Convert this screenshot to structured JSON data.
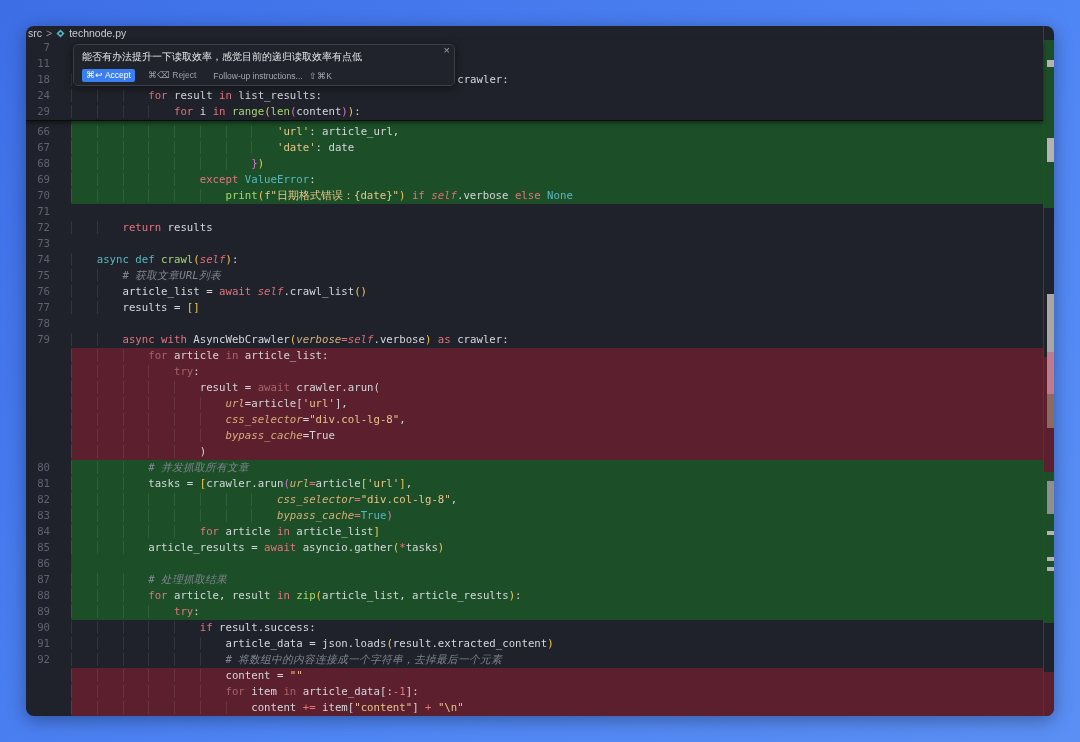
{
  "breadcrumb": {
    "folder": "src",
    "separator": ">",
    "file": "technode.py"
  },
  "prompt_popup": {
    "prompt": "能否有办法提升一下读取效率，感觉目前的递归读取效率有点低",
    "accept": "⌘↩ Accept",
    "reject": "⌘⌫ Reject",
    "followup_placeholder": "Follow-up instructions...",
    "followup_shortcut": "⇧⌘K",
    "close": "×"
  },
  "sticky_lines": [
    {
      "num": "7"
    },
    {
      "num": "11"
    },
    {
      "num": "18",
      "code": [
        {
          "text": "                                                            crawler:",
          "kind": "plain"
        }
      ]
    },
    {
      "num": "24",
      "code": [
        {
          "text": "            for ",
          "kind": "keyword"
        },
        {
          "text": "result ",
          "kind": "plain"
        },
        {
          "text": "in ",
          "kind": "keyword"
        },
        {
          "text": "list_results:",
          "kind": "plain"
        }
      ]
    },
    {
      "num": "29",
      "code": [
        {
          "text": "                for ",
          "kind": "keyword"
        },
        {
          "text": "i ",
          "kind": "plain"
        },
        {
          "text": "in ",
          "kind": "keyword"
        },
        {
          "text": "range",
          "kind": "function"
        },
        {
          "text": "(",
          "kind": "bracket"
        },
        {
          "text": "len",
          "kind": "function"
        },
        {
          "text": "(",
          "kind": "bracket2"
        },
        {
          "text": "content",
          "kind": "plain"
        },
        {
          "text": ")",
          "kind": "bracket2"
        },
        {
          "text": ")",
          "kind": "bracket"
        },
        {
          "text": ":",
          "kind": "plain"
        }
      ]
    }
  ],
  "lines": [
    {
      "num": "66",
      "kind": "added",
      "code": [
        {
          "text": "                                'url'",
          "kind": "string"
        },
        {
          "text": ": article_url,",
          "kind": "plain"
        }
      ]
    },
    {
      "num": "67",
      "kind": "added",
      "code": [
        {
          "text": "                                'date'",
          "kind": "string"
        },
        {
          "text": ": date",
          "kind": "plain"
        }
      ]
    },
    {
      "num": "68",
      "kind": "added",
      "code": [
        {
          "text": "                            }",
          "kind": "bracket2"
        },
        {
          "text": ")",
          "kind": "bracket"
        }
      ]
    },
    {
      "num": "69",
      "kind": "added",
      "code": [
        {
          "text": "                    except ",
          "kind": "keyword"
        },
        {
          "text": "ValueError",
          "kind": "constant"
        },
        {
          "text": ":",
          "kind": "plain"
        }
      ]
    },
    {
      "num": "70",
      "kind": "added",
      "code": [
        {
          "text": "                        print",
          "kind": "function"
        },
        {
          "text": "(",
          "kind": "bracket"
        },
        {
          "text": "f\"日期格式错误：{date}\"",
          "kind": "string"
        },
        {
          "text": ") ",
          "kind": "bracket"
        },
        {
          "text": "if ",
          "kind": "keyword"
        },
        {
          "text": "self",
          "kind": "self"
        },
        {
          "text": ".verbose ",
          "kind": "plain"
        },
        {
          "text": "else ",
          "kind": "keyword"
        },
        {
          "text": "None",
          "kind": "constant"
        }
      ]
    },
    {
      "num": "71",
      "kind": "plain"
    },
    {
      "num": "72",
      "kind": "plain",
      "code": [
        {
          "text": "        return ",
          "kind": "keyword"
        },
        {
          "text": "results",
          "kind": "plain"
        }
      ]
    },
    {
      "num": "73",
      "kind": "plain"
    },
    {
      "num": "74",
      "kind": "plain",
      "code": [
        {
          "text": "    async def ",
          "kind": "declaration"
        },
        {
          "text": "crawl",
          "kind": "function"
        },
        {
          "text": "(",
          "kind": "bracket"
        },
        {
          "text": "self",
          "kind": "self"
        },
        {
          "text": ")",
          "kind": "bracket"
        },
        {
          "text": ":",
          "kind": "plain"
        }
      ]
    },
    {
      "num": "75",
      "kind": "plain",
      "code": [
        {
          "text": "        # 获取文章URL列表",
          "kind": "comment"
        }
      ]
    },
    {
      "num": "76",
      "kind": "plain",
      "code": [
        {
          "text": "        article_list = ",
          "kind": "plain"
        },
        {
          "text": "await ",
          "kind": "keyword"
        },
        {
          "text": "self",
          "kind": "self"
        },
        {
          "text": ".crawl_list",
          "kind": "plain"
        },
        {
          "text": "()",
          "kind": "bracket"
        }
      ]
    },
    {
      "num": "77",
      "kind": "plain",
      "code": [
        {
          "text": "        results = ",
          "kind": "plain"
        },
        {
          "text": "[]",
          "kind": "bracket"
        }
      ]
    },
    {
      "num": "78",
      "kind": "plain"
    },
    {
      "num": "79",
      "kind": "plain",
      "code": [
        {
          "text": "        async with ",
          "kind": "keyword"
        },
        {
          "text": "AsyncWebCrawler",
          "kind": "plain"
        },
        {
          "text": "(",
          "kind": "bracket"
        },
        {
          "text": "verbose",
          "kind": "param"
        },
        {
          "text": "=",
          "kind": "operator"
        },
        {
          "text": "self",
          "kind": "self"
        },
        {
          "text": ".verbose",
          "kind": "plain"
        },
        {
          "text": ") ",
          "kind": "bracket"
        },
        {
          "text": "as ",
          "kind": "keyword"
        },
        {
          "text": "crawler:",
          "kind": "plain"
        }
      ]
    },
    {
      "kind": "deleted",
      "code": [
        {
          "text": "            for ",
          "kind": "keyword"
        },
        {
          "text": "article ",
          "kind": "plain"
        },
        {
          "text": "in ",
          "kind": "keyword"
        },
        {
          "text": "article_list:",
          "kind": "plain"
        }
      ]
    },
    {
      "kind": "deleted",
      "code": [
        {
          "text": "                try",
          "kind": "keyword"
        },
        {
          "text": ":",
          "kind": "plain"
        }
      ]
    },
    {
      "kind": "deleted",
      "code": [
        {
          "text": "                    result = ",
          "kind": "plain"
        },
        {
          "text": "await ",
          "kind": "keyword"
        },
        {
          "text": "crawler.arun(",
          "kind": "plain"
        }
      ]
    },
    {
      "kind": "deleted",
      "code": [
        {
          "text": "                        url",
          "kind": "param"
        },
        {
          "text": "=article[",
          "kind": "plain"
        },
        {
          "text": "'url'",
          "kind": "string"
        },
        {
          "text": "],",
          "kind": "plain"
        }
      ]
    },
    {
      "kind": "deleted",
      "code": [
        {
          "text": "                        css_selector",
          "kind": "param"
        },
        {
          "text": "=",
          "kind": "plain"
        },
        {
          "text": "\"div.col-lg-8\"",
          "kind": "string"
        },
        {
          "text": ",",
          "kind": "plain"
        }
      ]
    },
    {
      "kind": "deleted",
      "code": [
        {
          "text": "                        bypass_cache",
          "kind": "param"
        },
        {
          "text": "=True",
          "kind": "plain"
        }
      ]
    },
    {
      "kind": "deleted",
      "code": [
        {
          "text": "                    )",
          "kind": "plain"
        }
      ]
    },
    {
      "num": "80",
      "kind": "added",
      "code": [
        {
          "text": "            # 并发抓取所有文章",
          "kind": "comment"
        }
      ]
    },
    {
      "num": "81",
      "kind": "added",
      "code": [
        {
          "text": "            tasks = ",
          "kind": "plain"
        },
        {
          "text": "[",
          "kind": "bracket"
        },
        {
          "text": "crawler.arun",
          "kind": "plain"
        },
        {
          "text": "(",
          "kind": "bracket2"
        },
        {
          "text": "url",
          "kind": "param"
        },
        {
          "text": "=",
          "kind": "operator"
        },
        {
          "text": "article",
          "kind": "plain"
        },
        {
          "text": "[",
          "kind": "bracket"
        },
        {
          "text": "'url'",
          "kind": "string"
        },
        {
          "text": "]",
          "kind": "bracket"
        },
        {
          "text": ",",
          "kind": "plain"
        }
      ]
    },
    {
      "num": "82",
      "kind": "added",
      "code": [
        {
          "text": "                                css_selector",
          "kind": "param"
        },
        {
          "text": "=",
          "kind": "operator"
        },
        {
          "text": "\"div.col-lg-8\"",
          "kind": "string"
        },
        {
          "text": ",",
          "kind": "plain"
        }
      ]
    },
    {
      "num": "83",
      "kind": "added",
      "code": [
        {
          "text": "                                bypass_cache",
          "kind": "param"
        },
        {
          "text": "=",
          "kind": "operator"
        },
        {
          "text": "True",
          "kind": "constant"
        },
        {
          "text": ")",
          "kind": "bracket2"
        }
      ]
    },
    {
      "num": "84",
      "kind": "added",
      "code": [
        {
          "text": "                    for ",
          "kind": "keyword"
        },
        {
          "text": "article ",
          "kind": "plain"
        },
        {
          "text": "in ",
          "kind": "keyword"
        },
        {
          "text": "article_list",
          "kind": "plain"
        },
        {
          "text": "]",
          "kind": "bracket"
        }
      ]
    },
    {
      "num": "85",
      "kind": "added",
      "code": [
        {
          "text": "            article_results = ",
          "kind": "plain"
        },
        {
          "text": "await ",
          "kind": "keyword"
        },
        {
          "text": "asyncio.gather",
          "kind": "plain"
        },
        {
          "text": "(",
          "kind": "bracket"
        },
        {
          "text": "*",
          "kind": "operator"
        },
        {
          "text": "tasks",
          "kind": "plain"
        },
        {
          "text": ")",
          "kind": "bracket"
        }
      ]
    },
    {
      "num": "86",
      "kind": "added"
    },
    {
      "num": "87",
      "kind": "added",
      "code": [
        {
          "text": "            # 处理抓取结果",
          "kind": "comment"
        }
      ]
    },
    {
      "num": "88",
      "kind": "added",
      "code": [
        {
          "text": "            for ",
          "kind": "keyword"
        },
        {
          "text": "article, result ",
          "kind": "plain"
        },
        {
          "text": "in ",
          "kind": "keyword"
        },
        {
          "text": "zip",
          "kind": "function"
        },
        {
          "text": "(",
          "kind": "bracket"
        },
        {
          "text": "article_list, article_results",
          "kind": "plain"
        },
        {
          "text": ")",
          "kind": "bracket"
        },
        {
          "text": ":",
          "kind": "plain"
        }
      ]
    },
    {
      "num": "89",
      "kind": "added",
      "code": [
        {
          "text": "                try",
          "kind": "keyword"
        },
        {
          "text": ":",
          "kind": "plain"
        }
      ]
    },
    {
      "num": "90",
      "kind": "plain",
      "code": [
        {
          "text": "                    if ",
          "kind": "keyword"
        },
        {
          "text": "result.success:",
          "kind": "plain"
        }
      ]
    },
    {
      "num": "91",
      "kind": "plain",
      "code": [
        {
          "text": "                        article_data = json.loads",
          "kind": "plain"
        },
        {
          "text": "(",
          "kind": "bracket"
        },
        {
          "text": "result.extracted_content",
          "kind": "plain"
        },
        {
          "text": ")",
          "kind": "bracket"
        }
      ]
    },
    {
      "num": "92",
      "kind": "plain",
      "code": [
        {
          "text": "                        # 将数组中的内容连接成一个字符串，去掉最后一个元素",
          "kind": "comment"
        }
      ]
    },
    {
      "kind": "deleted",
      "code": [
        {
          "text": "                        content = ",
          "kind": "plain"
        },
        {
          "text": "\"\"",
          "kind": "string"
        }
      ]
    },
    {
      "kind": "deleted",
      "code": [
        {
          "text": "                        for ",
          "kind": "keyword"
        },
        {
          "text": "item ",
          "kind": "plain"
        },
        {
          "text": "in ",
          "kind": "keyword"
        },
        {
          "text": "article_data[:",
          "kind": "plain"
        },
        {
          "text": "-1",
          "kind": "operator"
        },
        {
          "text": "]:",
          "kind": "plain"
        }
      ]
    },
    {
      "kind": "deleted",
      "code": [
        {
          "text": "                            content ",
          "kind": "plain"
        },
        {
          "text": "+=",
          "kind": "operator"
        },
        {
          "text": " item[",
          "kind": "plain"
        },
        {
          "text": "\"content\"",
          "kind": "string"
        },
        {
          "text": "] ",
          "kind": "plain"
        },
        {
          "text": "+",
          "kind": "operator"
        },
        {
          "text": " \"\\n\"",
          "kind": "string"
        }
      ]
    }
  ]
}
